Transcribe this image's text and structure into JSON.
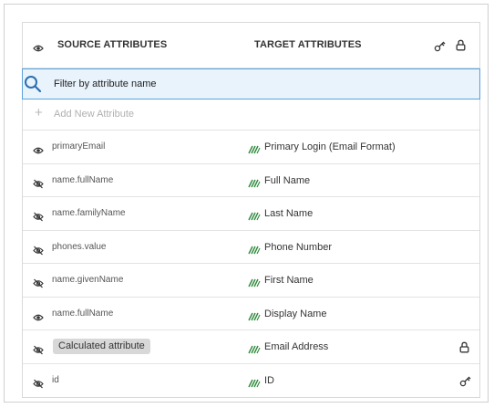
{
  "header": {
    "source_title": "SOURCE ATTRIBUTES",
    "target_title": "TARGET ATTRIBUTES",
    "icons": [
      "eye-icon",
      "key-icon",
      "lock-icon"
    ]
  },
  "filter": {
    "placeholder": "Filter by attribute name",
    "icon": "search-icon"
  },
  "add": {
    "label": "Add New Attribute",
    "icon": "plus-icon"
  },
  "colors": {
    "accent_blue": "#2a6fb0",
    "filter_bg": "#e9f3fc",
    "mapping_green": "#2f8a3c",
    "badge_bg": "#d8d8d8"
  },
  "rows": [
    {
      "source": "primaryEmail",
      "visible": true,
      "target": "Primary Login (Email Format)"
    },
    {
      "source": "name.fullName",
      "visible": false,
      "target": "Full Name"
    },
    {
      "source": "name.familyName",
      "visible": false,
      "target": "Last Name"
    },
    {
      "source": "phones.value",
      "visible": false,
      "target": "Phone Number"
    },
    {
      "source": "name.givenName",
      "visible": false,
      "target": "First Name"
    },
    {
      "source": "name.fullName",
      "visible": true,
      "target": "Display Name"
    },
    {
      "source": "Calculated attribute",
      "visible": false,
      "badge": true,
      "target": "Email Address",
      "end_icon": "lock-icon"
    },
    {
      "source": "id",
      "visible": false,
      "target": "ID",
      "end_icon": "key-icon"
    }
  ]
}
